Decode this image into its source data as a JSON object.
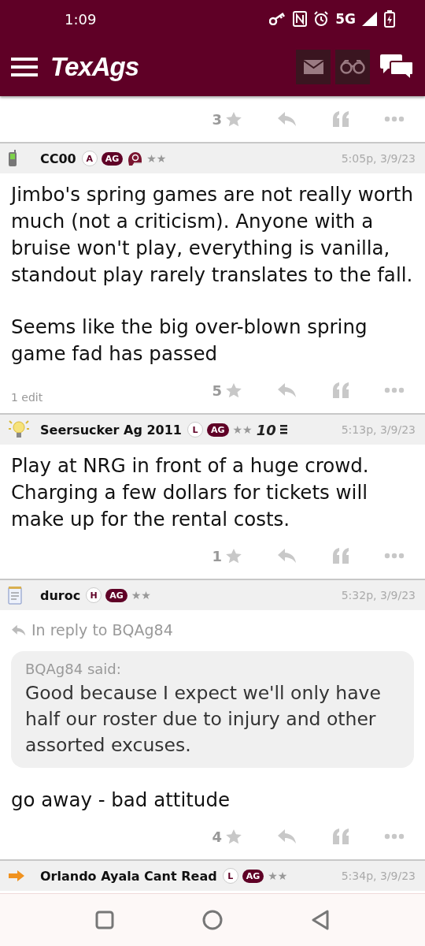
{
  "status_bar": {
    "time": "1:09",
    "network": "5G"
  },
  "app_bar": {
    "logo": "TexAgs"
  },
  "top_footer": {
    "likes": "3"
  },
  "posts": [
    {
      "avatar": {
        "kind": "phone"
      },
      "username": "CC00",
      "badges": [
        {
          "kind": "letter",
          "text": "A"
        },
        {
          "kind": "ag",
          "text": "AG"
        },
        {
          "kind": "helmet"
        }
      ],
      "rank": "★★",
      "time": "5:05p, 3/9/23",
      "paragraphs": [
        "Jimbo's spring games are not really worth much (not a criticism). Anyone with a bruise won't play, everything is vanilla, standout play rarely translates to the fall.",
        "Seems like the big over-blown spring game fad has passed"
      ],
      "edit_note": "1 edit",
      "likes": "5"
    },
    {
      "avatar": {
        "kind": "lightbulb"
      },
      "username": "Seersucker Ag 2011",
      "badges": [
        {
          "kind": "letter",
          "text": "L"
        },
        {
          "kind": "ag",
          "text": "AG"
        }
      ],
      "rank": "★★",
      "award": "10",
      "time": "5:13p, 3/9/23",
      "paragraphs": [
        "Play at NRG in front of a huge crowd. Charging a few dollars for tickets will make up for the rental costs."
      ],
      "likes": "1"
    },
    {
      "avatar": {
        "kind": "notepad"
      },
      "username": "duroc",
      "badges": [
        {
          "kind": "letter",
          "text": "H"
        },
        {
          "kind": "ag",
          "text": "AG"
        }
      ],
      "rank": "★★",
      "time": "5:32p, 3/9/23",
      "reply_to": "In reply to BQAg84",
      "quote": {
        "author": "BQAg84 said:",
        "text": "Good because I expect we'll only have half our roster due to injury and other assorted excuses."
      },
      "paragraphs": [
        "go away - bad attitude"
      ],
      "likes": "4"
    },
    {
      "avatar": {
        "kind": "arrow"
      },
      "username": "Orlando Ayala Cant Read",
      "badges": [
        {
          "kind": "letter",
          "text": "L"
        },
        {
          "kind": "ag",
          "text": "AG"
        }
      ],
      "rank": "★★",
      "time": "5:34p, 3/9/23"
    }
  ]
}
